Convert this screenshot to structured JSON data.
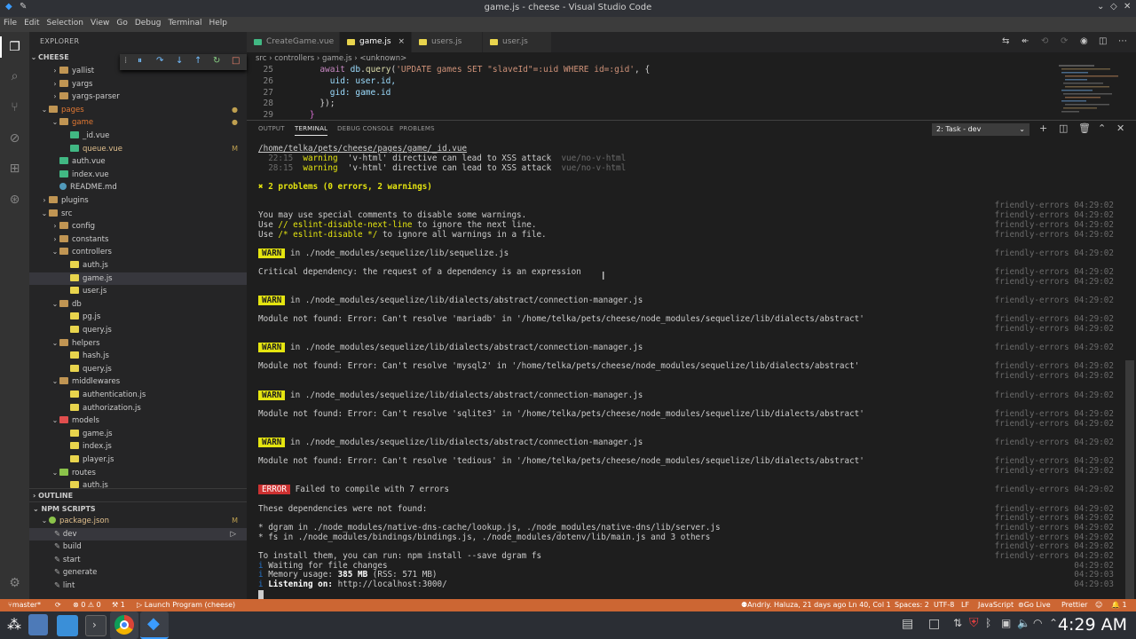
{
  "window": {
    "title": "game.js - cheese - Visual Studio Code"
  },
  "menu": [
    "File",
    "Edit",
    "Selection",
    "View",
    "Go",
    "Debug",
    "Terminal",
    "Help"
  ],
  "explorer": {
    "header": "EXPLORER",
    "root": "CHEESE",
    "rows": [
      {
        "label": "yallist",
        "indent": 1,
        "type": "folder",
        "chev": "›"
      },
      {
        "label": "yargs",
        "indent": 1,
        "type": "folder",
        "chev": "›"
      },
      {
        "label": "yargs-parser",
        "indent": 1,
        "type": "folder",
        "chev": "›"
      },
      {
        "label": "pages",
        "indent": 0,
        "type": "folder",
        "chev": "⌄",
        "color": "#e37933",
        "badge": "●"
      },
      {
        "label": "game",
        "indent": 1,
        "type": "folder",
        "chev": "⌄",
        "color": "#e37933",
        "badge": "●"
      },
      {
        "label": "_id.vue",
        "indent": 2,
        "type": "vue"
      },
      {
        "label": "queue.vue",
        "indent": 2,
        "type": "vue",
        "color": "#e2c08d",
        "badge": "M"
      },
      {
        "label": "auth.vue",
        "indent": 1,
        "type": "vue"
      },
      {
        "label": "index.vue",
        "indent": 1,
        "type": "vue"
      },
      {
        "label": "README.md",
        "indent": 1,
        "type": "md"
      },
      {
        "label": "plugins",
        "indent": 0,
        "type": "folder",
        "chev": "›"
      },
      {
        "label": "src",
        "indent": 0,
        "type": "folder",
        "chev": "⌄"
      },
      {
        "label": "config",
        "indent": 1,
        "type": "folder",
        "chev": "›"
      },
      {
        "label": "constants",
        "indent": 1,
        "type": "folder",
        "chev": "›"
      },
      {
        "label": "controllers",
        "indent": 1,
        "type": "folder",
        "chev": "⌄"
      },
      {
        "label": "auth.js",
        "indent": 2,
        "type": "js"
      },
      {
        "label": "game.js",
        "indent": 2,
        "type": "js",
        "selected": true
      },
      {
        "label": "user.js",
        "indent": 2,
        "type": "js"
      },
      {
        "label": "db",
        "indent": 1,
        "type": "folder",
        "chev": "⌄"
      },
      {
        "label": "pg.js",
        "indent": 2,
        "type": "js"
      },
      {
        "label": "query.js",
        "indent": 2,
        "type": "js"
      },
      {
        "label": "helpers",
        "indent": 1,
        "type": "folder",
        "chev": "⌄"
      },
      {
        "label": "hash.js",
        "indent": 2,
        "type": "js"
      },
      {
        "label": "query.js",
        "indent": 2,
        "type": "js"
      },
      {
        "label": "middlewares",
        "indent": 1,
        "type": "folder",
        "chev": "⌄"
      },
      {
        "label": "authentication.js",
        "indent": 2,
        "type": "js"
      },
      {
        "label": "authorization.js",
        "indent": 2,
        "type": "js"
      },
      {
        "label": "models",
        "indent": 1,
        "type": "folder",
        "chev": "⌄",
        "fcolor": "#e04e4e"
      },
      {
        "label": "game.js",
        "indent": 2,
        "type": "js"
      },
      {
        "label": "index.js",
        "indent": 2,
        "type": "js"
      },
      {
        "label": "player.js",
        "indent": 2,
        "type": "js"
      },
      {
        "label": "routes",
        "indent": 1,
        "type": "folder",
        "chev": "⌄",
        "fcolor": "#8bc34a"
      },
      {
        "label": "auth.js",
        "indent": 2,
        "type": "js"
      }
    ],
    "outline": "OUTLINE",
    "npm_scripts": "NPM SCRIPTS",
    "package": "package.json",
    "package_badge": "M",
    "scripts": [
      "dev",
      "build",
      "start",
      "generate",
      "lint"
    ]
  },
  "tabs": [
    {
      "label": "CreateGame.vue",
      "icon": "#41b883",
      "active": false
    },
    {
      "label": "game.js",
      "icon": "#e8d44d",
      "active": true,
      "close": "×"
    },
    {
      "label": "users.js",
      "icon": "#e8d44d",
      "active": false
    },
    {
      "label": "user.js",
      "icon": "#e8d44d",
      "active": false
    }
  ],
  "breadcrumb": "src › controllers › game.js › <unknown>",
  "code": [
    {
      "n": "25",
      "t": "      await db.query('UPDATE games SET \"slaveId\"=:uid WHERE id=:gid', {"
    },
    {
      "n": "26",
      "t": "        uid: user.id,"
    },
    {
      "n": "27",
      "t": "        gid: game.id"
    },
    {
      "n": "28",
      "t": "      });"
    },
    {
      "n": "29",
      "t": "    }"
    }
  ],
  "panel": {
    "tabs": [
      "OUTPUT",
      "TERMINAL",
      "DEBUG CONSOLE",
      "PROBLEMS"
    ],
    "active_tab": "TERMINAL",
    "task": "2: Task - dev"
  },
  "terminal": {
    "file_path": "/home/telka/pets/cheese/pages/game/_id.vue",
    "warn1_loc": "  22:15  ",
    "warn2_loc": "  28:15  ",
    "warn_word": "warning",
    "warn_msg": "  'v-html' directive can lead to XSS attack  ",
    "warn_rule": "vue/no-v-html",
    "problems": "✖ 2 problems (0 errors, 2 warnings)",
    "comment1": "You may use special comments to disable some warnings.",
    "comment2a": "Use ",
    "comment2b": "// eslint-disable-next-line",
    "comment2c": " to ignore the next line.",
    "comment3a": "Use ",
    "comment3b": "/* eslint-disable */",
    "comment3c": " to ignore all warnings in a file.",
    "warn_tag": "WARN",
    "warn_seq": " in ./node_modules/sequelize/lib/sequelize.js",
    "crit_dep": "Critical dependency: the request of a dependency is an expression",
    "warn_conn": " in ./node_modules/sequelize/lib/dialects/abstract/connection-manager.js",
    "mod_mariadb": "Module not found: Error: Can't resolve 'mariadb' in '/home/telka/pets/cheese/node_modules/sequelize/lib/dialects/abstract'",
    "mod_mysql2": "Module not found: Error: Can't resolve 'mysql2' in '/home/telka/pets/cheese/node_modules/sequelize/lib/dialects/abstract'",
    "mod_sqlite3": "Module not found: Error: Can't resolve 'sqlite3' in '/home/telka/pets/cheese/node_modules/sequelize/lib/dialects/abstract'",
    "mod_tedious": "Module not found: Error: Can't resolve 'tedious' in '/home/telka/pets/cheese/node_modules/sequelize/lib/dialects/abstract'",
    "error_tag": "ERROR",
    "error_msg": " Failed to compile with 7 errors",
    "deps_not_found": "These dependencies were not found:",
    "dep1": "* dgram in ./node_modules/native-dns-cache/lookup.js, ./node_modules/native-dns/lib/server.js",
    "dep2": "* fs in ./node_modules/bindings/bindings.js, ./node_modules/dotenv/lib/main.js and 3 others",
    "install": "To install them, you can run: npm install --save dgram fs",
    "info_icon": "i",
    "waiting": " Waiting for file changes",
    "mem_label": " Memory usage: ",
    "mem_value": "385 MB",
    "mem_rss": " (RSS: 571 MB)",
    "listen_label": " Listening on: ",
    "listen_url": "http://localhost:3000/",
    "fe": "friendly-errors 04:29:02",
    "t1": "04:29:02",
    "t2": "04:29:03"
  },
  "status": {
    "branch": "master*",
    "sync": "⟳",
    "errors": "⊗ 0  ⚠ 0",
    "tasks": "⚒ 1",
    "launch": "▷ Launch Program (cheese)",
    "blame": "Andriy. Haluza, 21 days ago",
    "position": "Ln 40, Col 1",
    "spaces": "Spaces: 2",
    "encoding": "UTF-8",
    "eol": "LF",
    "language": "JavaScript",
    "golive": "Go Live",
    "prettier": "Prettier",
    "bell": "🔔 1"
  },
  "taskbar": {
    "clock": "4:29 AM"
  },
  "colors": {
    "accent": "#cc6633",
    "warn": "#e5e510",
    "error": "#cd3131"
  }
}
